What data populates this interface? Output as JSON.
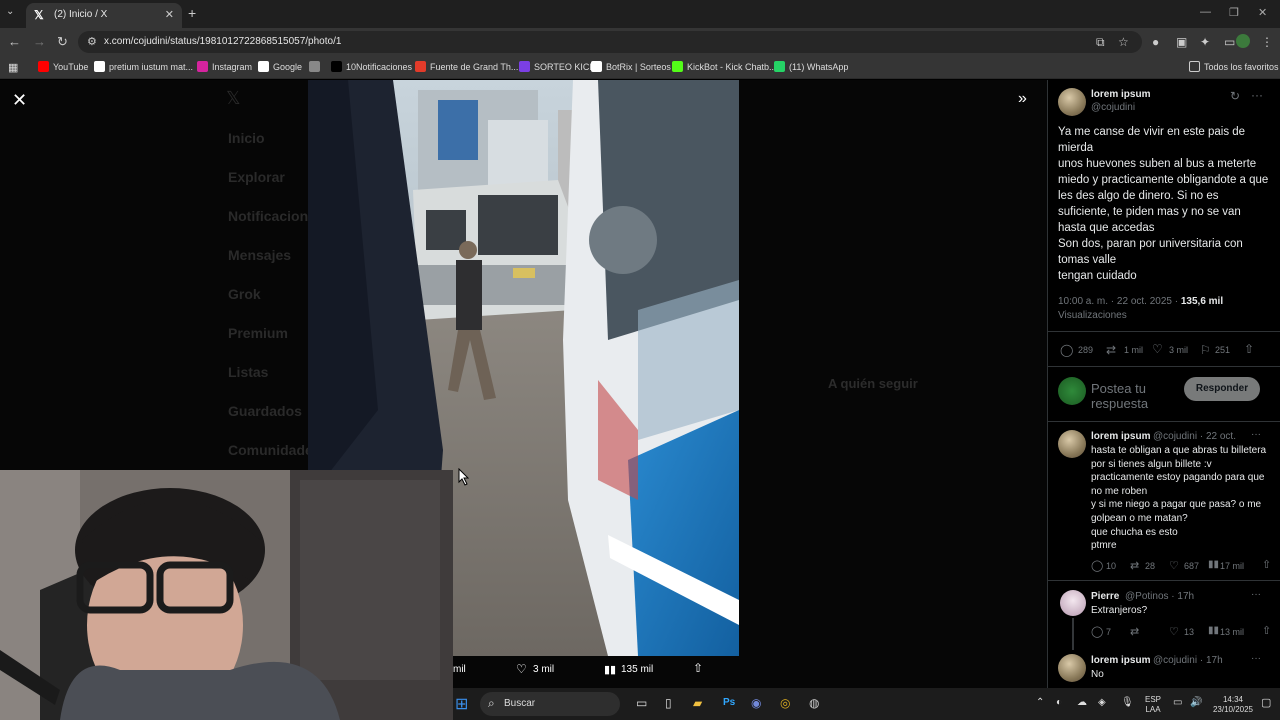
{
  "browser": {
    "tab_title": "(2) Inicio / X",
    "url": "x.com/cojudini/status/1981012722868515057/photo/1",
    "bookmarks": [
      {
        "label": "YouTube",
        "color": "#ff0000",
        "icon": "youtube-icon"
      },
      {
        "label": "pretium iustum mat...",
        "color": "#ffffff",
        "icon": "google-icon"
      },
      {
        "label": "Instagram",
        "color": "#d6249f",
        "icon": "instagram-icon"
      },
      {
        "label": "Google",
        "color": "#ffffff",
        "icon": "google-icon"
      },
      {
        "label": "",
        "color": "#888888",
        "icon": "globe-icon"
      },
      {
        "label": "10Notificaciones",
        "color": "#000000",
        "icon": "x-icon"
      },
      {
        "label": "Fuente de Grand Th...",
        "color": "#e23b2a",
        "icon": "font-icon"
      },
      {
        "label": "SORTEO KICK",
        "color": "#7b3fe4",
        "icon": "twitch-icon"
      },
      {
        "label": "BotRix | Sorteos",
        "color": "#ffffff",
        "icon": "diamond-icon"
      },
      {
        "label": "KickBot - Kick Chatb...",
        "color": "#53fc18",
        "icon": "kick-icon"
      },
      {
        "label": "(11) WhatsApp",
        "color": "#25d366",
        "icon": "whatsapp-icon"
      }
    ],
    "all_favorites": "Todos los favoritos"
  },
  "bg_nav": [
    "Inicio",
    "Explorar",
    "Notificaciones",
    "Mensajes",
    "Grok",
    "Premium",
    "Listas",
    "Guardados",
    "Comunidades"
  ],
  "photo_actions": {
    "left_label": "mil",
    "likes": "3 mil",
    "views": "135 mil"
  },
  "tweet": {
    "name": "lorem ipsum",
    "handle": "@cojudini",
    "text_lines": [
      "Ya me canse de vivir en este pais de mierda",
      "unos huevones suben al bus a meterte miedo y practicamente obligandote a que les des algo de dinero. Si no es suficiente, te piden mas y no se van hasta que accedas",
      "Son dos, paran por universitaria con tomas valle",
      "tengan cuidado"
    ],
    "time": "10:00 a. m. · 22 oct. 2025 · ",
    "views": "135,6 mil",
    "views_label": "Visualizaciones",
    "replies": "289",
    "reposts": "1 mil",
    "likes": "3 mil",
    "bookmarks": "251",
    "reply_placeholder": "Postea tu respuesta",
    "reply_button": "Responder"
  },
  "replies": [
    {
      "name": "lorem ipsum",
      "handle": "@cojudini · 22 oct.",
      "lines": [
        "hasta te obligan a que abras tu billetera por si tienes algun billete :v",
        "practicamente estoy pagando para que no me roben",
        "y si me niego a pagar que pasa? o me golpean o me matan?",
        "que chucha es esto",
        "ptmre"
      ],
      "replies": "10",
      "reposts": "28",
      "likes": "687",
      "views": "17 mil"
    },
    {
      "name": "Pierre",
      "handle": "@Potinos · 17h",
      "lines": [
        "Extranjeros?"
      ],
      "replies": "7",
      "reposts": "",
      "likes": "13",
      "views": "13 mil"
    },
    {
      "name": "lorem ipsum",
      "handle": "@cojudini · 17h",
      "lines": [
        "No"
      ]
    }
  ],
  "taskbar": {
    "search": "Buscar",
    "lang1": "ESP",
    "lang2": "LAA",
    "time": "14:34",
    "date": "23/10/2025"
  }
}
